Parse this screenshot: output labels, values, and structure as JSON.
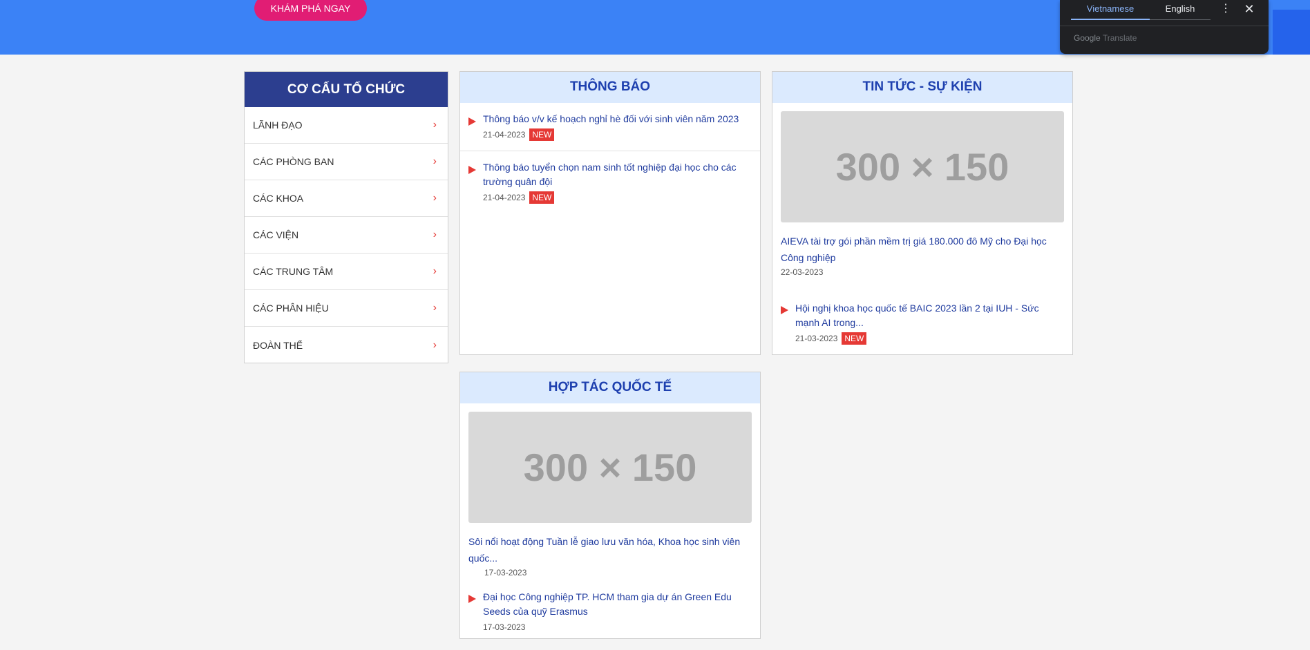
{
  "hero": {
    "explore_label": "KHÁM PHÁ NGAY"
  },
  "translate": {
    "tab_active": "Vietnamese",
    "tab_other": "English",
    "menu_icon": "⋮",
    "close_icon": "✕",
    "brand_google": "Google",
    "brand_translate": "Translate"
  },
  "org": {
    "title": "CƠ CẤU TỔ CHỨC",
    "items": [
      {
        "label": "LÃNH ĐẠO"
      },
      {
        "label": "CÁC PHÒNG BAN"
      },
      {
        "label": "CÁC KHOA"
      },
      {
        "label": "CÁC VIỆN"
      },
      {
        "label": "CÁC TRUNG TÂM"
      },
      {
        "label": "CÁC PHÂN HIỆU"
      },
      {
        "label": "ĐOÀN THỂ"
      }
    ]
  },
  "notices": {
    "title": "THÔNG BÁO",
    "items": [
      {
        "text": "Thông báo v/v kế hoạch nghỉ hè đối với sinh viên năm 2023",
        "date": "21-04-2023",
        "badge": "NEW"
      },
      {
        "text": "Thông báo tuyển chọn nam sinh tốt nghiệp đại học cho các trường quân đội",
        "date": "21-04-2023",
        "badge": "NEW"
      }
    ]
  },
  "news": {
    "title": "TIN TỨC - SỰ KIỆN",
    "image_label": "300 × 150",
    "featured": {
      "text": "AIEVA tài trợ gói phần mềm trị giá 180.000 đô Mỹ cho Đại học Công nghiệp",
      "date": "22-03-2023"
    },
    "items": [
      {
        "text": "Hội nghị khoa học quốc tế BAIC 2023 lần 2 tại IUH - Sức mạnh AI trong...",
        "date": "21-03-2023",
        "badge": "NEW"
      }
    ]
  },
  "intl": {
    "title": "HỢP TÁC QUỐC TẾ",
    "image_label": "300 × 150",
    "featured": {
      "text": "Sôi nổi hoạt động Tuần lễ giao lưu văn hóa, Khoa học sinh viên quốc...",
      "date": "17-03-2023"
    },
    "items": [
      {
        "text": "Đại học Công nghiệp TP. HCM tham gia dự án Green Edu Seeds của quỹ Erasmus",
        "date": "17-03-2023"
      }
    ]
  },
  "colors": {
    "hero": "#3b82f6",
    "accent_pink": "#e11d74",
    "org_header": "#2c3e8f",
    "panel_header": "#dbeafe",
    "link": "#1e3a9e",
    "badge": "#e53935"
  },
  "icons": {
    "org_chevron": "chevron-right-icon",
    "bullet": "triangle-right-icon"
  }
}
